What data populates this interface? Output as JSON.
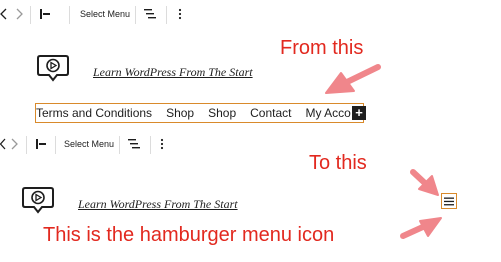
{
  "toolbar_top": {
    "select_menu_label": "Select Menu",
    "nav_left_icon": "chevron-left-icon",
    "nav_right_icon": "chevron-right-icon",
    "justify_icon": "justify-left-icon",
    "list_icon": "menu-lines-icon",
    "more_icon": "more-vertical-icon"
  },
  "site_top": {
    "logo_icon": "play-bubble-icon",
    "tagline": "Learn WordPress From The Start",
    "nav_items": [
      "Terms and Conditions",
      "Shop",
      "Shop",
      "Contact",
      "My Acco"
    ],
    "add_label": "+"
  },
  "toolbar_bottom": {
    "select_menu_label": "Select Menu"
  },
  "site_bottom": {
    "logo_icon": "play-bubble-icon",
    "tagline": "Learn WordPress From The Start",
    "hamburger_icon": "hamburger-menu-icon"
  },
  "annotations": {
    "from": "From this",
    "to": "To this",
    "hamburger_note": "This is the hamburger menu icon",
    "color": "#e2291f",
    "arrow_color": "#f0868b"
  }
}
